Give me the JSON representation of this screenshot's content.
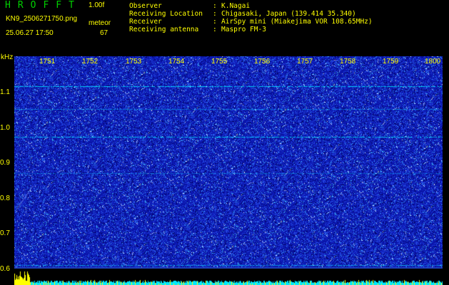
{
  "header": {
    "app_title": "HROFFT",
    "version": "1.00f",
    "filename": "KN9_2506271750.png",
    "mode_label": "meteor",
    "datetime": "25.06.27 17:50",
    "mode_value": "67"
  },
  "info": [
    {
      "key": "Observer",
      "value": "K.Nagai"
    },
    {
      "key": "Receiving Location",
      "value": "Chigasaki, Japan (139.414 35.340)"
    },
    {
      "key": "Receiver",
      "value": "AirSpy mini (Miakejima VOR 108.65MHz)"
    },
    {
      "key": "Receiving antenna",
      "value": "Maspro FM-3"
    }
  ],
  "plot": {
    "y_unit": "kHz",
    "y_ticks": [
      "1.1",
      "1.0",
      "0.9",
      "0.8",
      "0.7",
      "0.6"
    ],
    "x_ticks": [
      "1751",
      "1752",
      "1753",
      "1754",
      "1755",
      "1756",
      "1757",
      "1758",
      "1759",
      "1800"
    ],
    "colors": {
      "background": "#000000",
      "noise_base": "#0a14a8",
      "noise_hot": "#4a6cff",
      "signal_line": "#00e0ff",
      "label": "#ffff00"
    }
  }
}
